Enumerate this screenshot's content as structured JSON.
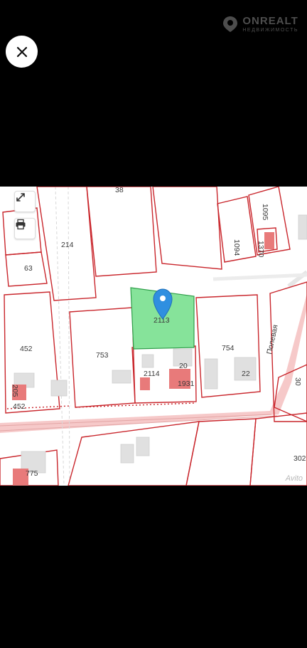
{
  "watermark": {
    "brand": "ONREALT",
    "subtitle": "НЕДВИЖИМОСТЬ"
  },
  "map": {
    "selected_parcel": "2113",
    "road_label": "Полевая",
    "parcel_labels": {
      "p38": "38",
      "p214": "214",
      "p63": "63",
      "p1094": "1094",
      "p1095": "1095",
      "p1370": "1370",
      "p452a": "452",
      "p205": "205",
      "p452b": "452",
      "p753": "753",
      "p2114": "2114",
      "p20": "20",
      "p1931": "1931",
      "p754": "754",
      "p22": "22",
      "p30": "30",
      "p775": "775",
      "p302": "302"
    },
    "provider": "Avito"
  },
  "colors": {
    "parcel_border": "#c9262c",
    "selected_fill": "#86e39a",
    "road": "#f6c9c9",
    "marker": "#2f8fe0"
  },
  "icons": {
    "close": "close-icon",
    "expand": "expand-icon",
    "print": "print-icon",
    "marker": "map-marker-icon"
  }
}
